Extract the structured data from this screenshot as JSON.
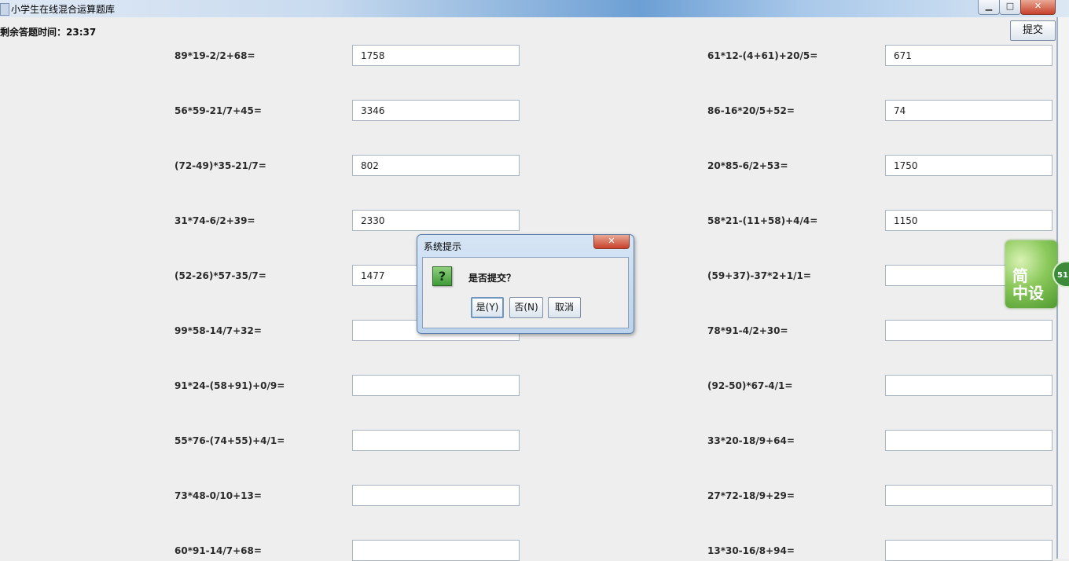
{
  "window": {
    "title": "小学生在线混合运算题库",
    "minimize": "▁",
    "maximize": "□",
    "close": "✕"
  },
  "header": {
    "timer_text": "剩余答题时间：23:37",
    "submit_label": "提交"
  },
  "questions_left": [
    {
      "expr": "89*19-2/2+68=",
      "answer": "1758"
    },
    {
      "expr": "56*59-21/7+45=",
      "answer": "3346"
    },
    {
      "expr": "(72-49)*35-21/7=",
      "answer": "802"
    },
    {
      "expr": "31*74-6/2+39=",
      "answer": "2330"
    },
    {
      "expr": "(52-26)*57-35/7=",
      "answer": "1477"
    },
    {
      "expr": "99*58-14/7+32=",
      "answer": ""
    },
    {
      "expr": "91*24-(58+91)+0/9=",
      "answer": ""
    },
    {
      "expr": "55*76-(74+55)+4/1=",
      "answer": ""
    },
    {
      "expr": "73*48-0/10+13=",
      "answer": ""
    },
    {
      "expr": "60*91-14/7+68=",
      "answer": ""
    }
  ],
  "questions_right": [
    {
      "expr": "61*12-(4+61)+20/5=",
      "answer": "671"
    },
    {
      "expr": "86-16*20/5+52=",
      "answer": "74"
    },
    {
      "expr": "20*85-6/2+53=",
      "answer": "1750"
    },
    {
      "expr": "58*21-(11+58)+4/4=",
      "answer": "1150"
    },
    {
      "expr": "(59+37)-37*2+1/1=",
      "answer": ""
    },
    {
      "expr": "78*91-4/2+30=",
      "answer": ""
    },
    {
      "expr": "(92-50)*67-4/1=",
      "answer": ""
    },
    {
      "expr": "33*20-18/9+64=",
      "answer": ""
    },
    {
      "expr": "27*72-18/9+29=",
      "answer": ""
    },
    {
      "expr": "13*30-16/8+94=",
      "answer": ""
    }
  ],
  "dialog": {
    "title": "系统提示",
    "close": "✕",
    "icon_glyph": "?",
    "message": "是否提交？",
    "yes_label": "是(Y)",
    "no_label": "否(N)",
    "cancel_label": "取消"
  },
  "side_widget": {
    "line1": "简",
    "line2": "中设",
    "badge": "51"
  },
  "icons": {
    "app": "java-app-icon",
    "question": "question-icon"
  }
}
